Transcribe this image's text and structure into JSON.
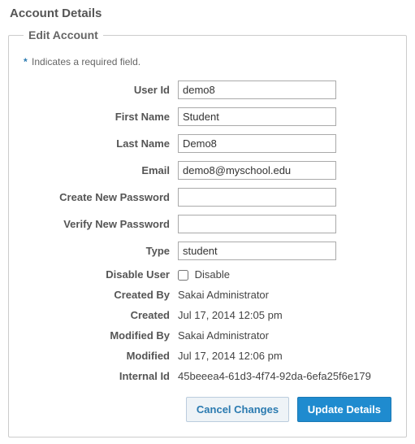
{
  "header": {
    "title": "Account Details"
  },
  "fieldset": {
    "legend": "Edit Account",
    "required_note_asterisk": "*",
    "required_note": "Indicates a required field."
  },
  "fields": {
    "user_id": {
      "label": "User Id",
      "value": "demo8"
    },
    "first_name": {
      "label": "First Name",
      "value": "Student"
    },
    "last_name": {
      "label": "Last Name",
      "value": "Demo8"
    },
    "email": {
      "label": "Email",
      "value": "demo8@myschool.edu"
    },
    "new_password": {
      "label": "Create New Password",
      "value": ""
    },
    "verify_password": {
      "label": "Verify New Password",
      "value": ""
    },
    "type": {
      "label": "Type",
      "value": "student"
    },
    "disable_user": {
      "label": "Disable User",
      "checkbox_label": "Disable",
      "checked": false
    },
    "created_by": {
      "label": "Created By",
      "value": "Sakai Administrator"
    },
    "created": {
      "label": "Created",
      "value": "Jul 17, 2014 12:05 pm"
    },
    "modified_by": {
      "label": "Modified By",
      "value": "Sakai Administrator"
    },
    "modified": {
      "label": "Modified",
      "value": "Jul 17, 2014 12:06 pm"
    },
    "internal_id": {
      "label": "Internal Id",
      "value": "45beeea4-61d3-4f74-92da-6efa25f6e179"
    }
  },
  "buttons": {
    "cancel": "Cancel Changes",
    "update": "Update Details"
  }
}
